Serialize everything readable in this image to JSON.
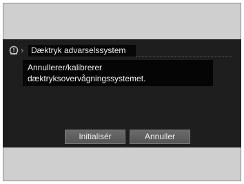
{
  "header": {
    "icon": "tpms-warning-icon",
    "title": "Dæktryk advarselssystem"
  },
  "message": {
    "line1": "Annullerer/kalibrerer",
    "line2": "dæktryksovervågningssystemet."
  },
  "buttons": {
    "initialize_label": "Initialisér",
    "cancel_label": "Annuller"
  }
}
